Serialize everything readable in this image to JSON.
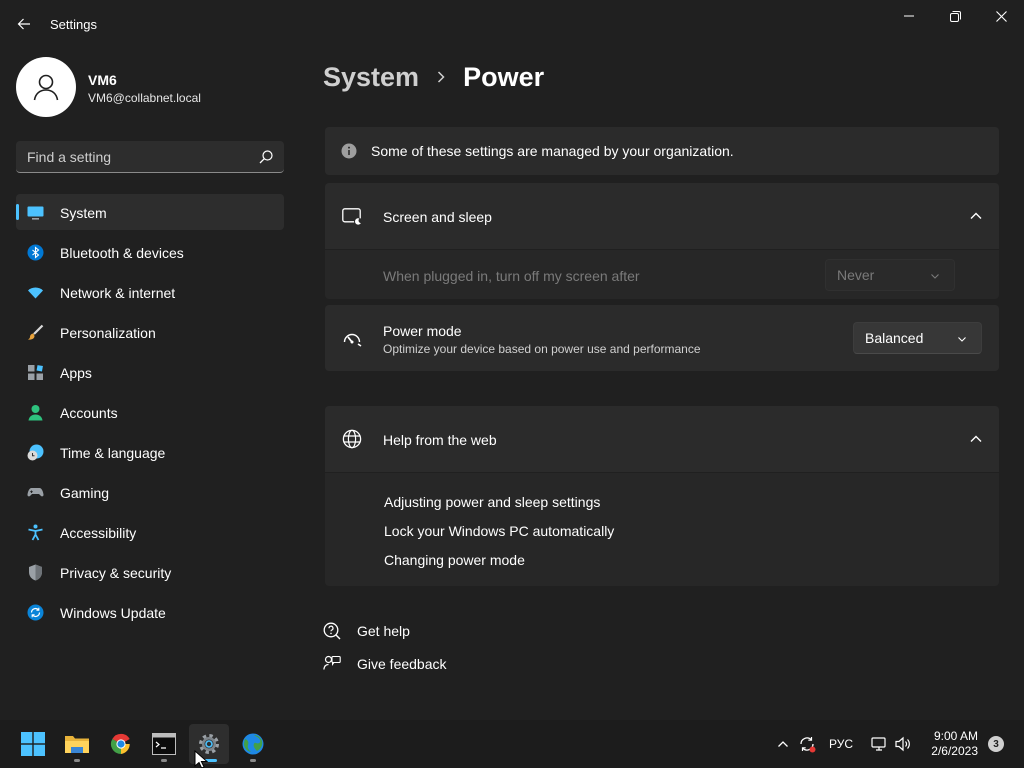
{
  "window": {
    "title": "Settings"
  },
  "account": {
    "name": "VM6",
    "email": "VM6@collabnet.local"
  },
  "search": {
    "placeholder": "Find a setting",
    "value": ""
  },
  "nav": {
    "selected": "System",
    "items": [
      {
        "label": "System",
        "icon": "system-icon",
        "color": "#4cc2ff"
      },
      {
        "label": "Bluetooth & devices",
        "icon": "bluetooth-icon",
        "color": "#0078d4"
      },
      {
        "label": "Network & internet",
        "icon": "wifi-icon",
        "color": "#4cc2ff"
      },
      {
        "label": "Personalization",
        "icon": "brush-icon",
        "color": "#e8a33d"
      },
      {
        "label": "Apps",
        "icon": "apps-icon",
        "color": "#9aa0a6"
      },
      {
        "label": "Accounts",
        "icon": "person-icon",
        "color": "#2ec27e"
      },
      {
        "label": "Time & language",
        "icon": "clock-globe-icon",
        "color": "#4cc2ff"
      },
      {
        "label": "Gaming",
        "icon": "gamepad-icon",
        "color": "#9aa0a6"
      },
      {
        "label": "Accessibility",
        "icon": "accessibility-icon",
        "color": "#4cc2ff"
      },
      {
        "label": "Privacy & security",
        "icon": "shield-icon",
        "color": "#9aa0a6"
      },
      {
        "label": "Windows Update",
        "icon": "update-icon",
        "color": "#0a84d8"
      }
    ]
  },
  "header": {
    "parent": "System",
    "current": "Power"
  },
  "banner": {
    "text": "Some of these settings are managed by your organization.",
    "icon": "info-icon"
  },
  "screen_sleep": {
    "title": "Screen and sleep",
    "expanded": true,
    "plugged_label": "When plugged in, turn off my screen after",
    "plugged_value": "Never"
  },
  "power_mode": {
    "title": "Power mode",
    "description": "Optimize your device based on power use and performance",
    "value": "Balanced"
  },
  "help": {
    "title": "Help from the web",
    "expanded": true,
    "links": [
      "Adjusting power and sleep settings",
      "Lock your Windows PC automatically",
      "Changing power mode"
    ]
  },
  "footer": {
    "get_help": "Get help",
    "give_feedback": "Give feedback"
  },
  "taskbar": {
    "apps": [
      {
        "name": "start",
        "icon": "windows-logo-icon"
      },
      {
        "name": "file-explorer",
        "icon": "folder-icon"
      },
      {
        "name": "chrome",
        "icon": "chrome-icon"
      },
      {
        "name": "terminal",
        "icon": "terminal-icon"
      },
      {
        "name": "settings",
        "icon": "gear-icon",
        "active": true
      },
      {
        "name": "globe-app",
        "icon": "globe-icon"
      }
    ],
    "language": "РУС",
    "time": "9:00 AM",
    "date": "2/6/2023",
    "notifications": "3"
  },
  "accent": "#4cc2ff"
}
